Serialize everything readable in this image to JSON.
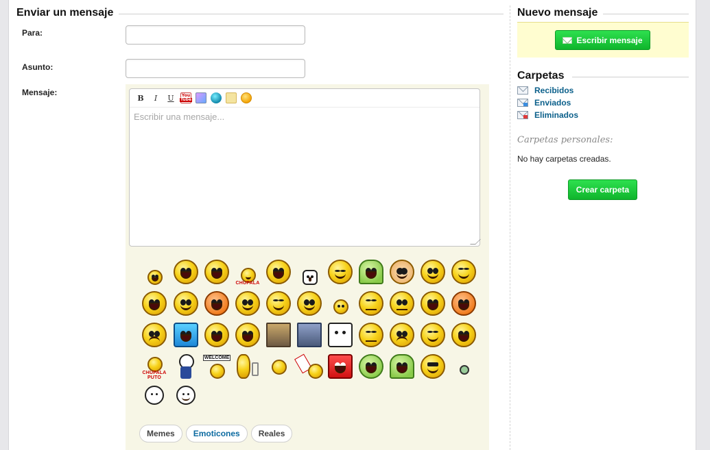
{
  "send": {
    "title": "Enviar un mensaje",
    "to_label": "Para:",
    "subject_label": "Asunto:",
    "message_label": "Mensaje:",
    "to_value": "",
    "subject_value": "",
    "message_placeholder": "Escribir una mensaje...",
    "toolbar": [
      {
        "name": "bold-icon",
        "glyph": "B"
      },
      {
        "name": "italic-icon",
        "glyph": "I"
      },
      {
        "name": "underline-icon",
        "glyph": "U"
      },
      {
        "name": "youtube-icon",
        "glyph": ""
      },
      {
        "name": "image-icon",
        "glyph": ""
      },
      {
        "name": "link-globe-icon",
        "glyph": ""
      },
      {
        "name": "quote-icon",
        "glyph": ""
      },
      {
        "name": "smiley-icon",
        "glyph": ""
      }
    ],
    "emoji_captions": {
      "chupala": "CHUPALA",
      "chupala_puto_1": "CHUPALA",
      "chupala_puto_2": "PUTO",
      "welcome": "WELCOME"
    },
    "emoji_tabs": [
      {
        "label": "Memes",
        "active": false
      },
      {
        "label": "Emoticones",
        "active": true
      },
      {
        "label": "Reales",
        "active": false
      }
    ]
  },
  "sidebar": {
    "new_title": "Nuevo mensaje",
    "write_button": "Escribir mensaje",
    "folders_title": "Carpetas",
    "folders": [
      {
        "label": "Recibidos",
        "icon": "inbox-envelope-icon"
      },
      {
        "label": "Enviados",
        "icon": "sent-envelope-icon"
      },
      {
        "label": "Eliminados",
        "icon": "deleted-envelope-icon"
      }
    ],
    "personal_title": "Carpetas personales:",
    "no_folders": "No hay carpetas creadas.",
    "create_button": "Crear carpeta"
  },
  "colors": {
    "green_button": "#14c936",
    "link_blue": "#0a5f8a",
    "composer_bg": "#f7f6e6",
    "new_box_bg": "#fffdd0"
  }
}
